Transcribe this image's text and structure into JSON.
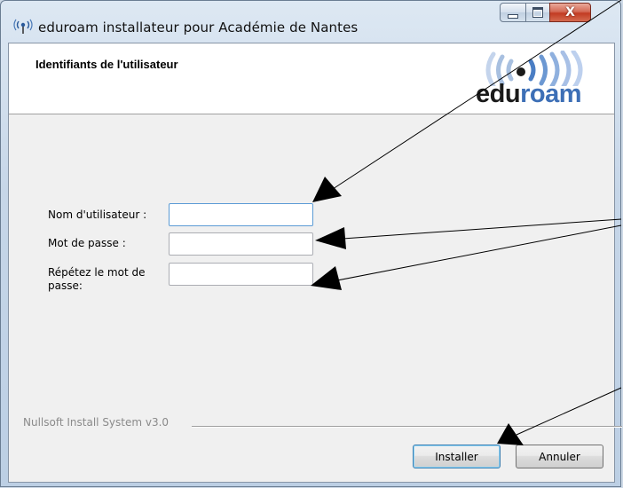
{
  "window": {
    "title": "eduroam installateur pour Académie de Nantes",
    "controls": {
      "minimize": "minimize",
      "maximize": "maximize",
      "close": "X"
    }
  },
  "header": {
    "page_title": "Identifiants de l'utilisateur",
    "logo": {
      "edu": "edu",
      "roam": "roam",
      "brand_color": "#3d6fb6"
    }
  },
  "form": {
    "username": {
      "label": "Nom d'utilisateur :",
      "value": ""
    },
    "password": {
      "label": "Mot de passe :",
      "value": ""
    },
    "password_repeat": {
      "label_line1": "Répétez le mot de",
      "label_line2": "passe:",
      "value": ""
    }
  },
  "footer": {
    "branding": "Nullsoft Install System v3.0",
    "install_button": "Installer",
    "cancel_button": "Annuler"
  },
  "icons": [
    "wifi-antenna-icon",
    "minimize-icon",
    "maximize-icon",
    "close-icon",
    "eduroam-logo"
  ]
}
